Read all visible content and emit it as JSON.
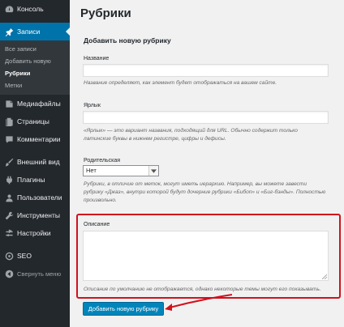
{
  "sidebar": {
    "items": [
      {
        "label": "Консоль",
        "icon": "dashboard-icon"
      },
      {
        "label": "Записи",
        "icon": "pin-icon",
        "active": true
      },
      {
        "label": "Медиафайлы",
        "icon": "media-icon"
      },
      {
        "label": "Страницы",
        "icon": "pages-icon"
      },
      {
        "label": "Комментарии",
        "icon": "comments-icon"
      },
      {
        "label": "Внешний вид",
        "icon": "brush-icon"
      },
      {
        "label": "Плагины",
        "icon": "plugin-icon"
      },
      {
        "label": "Пользователи",
        "icon": "users-icon"
      },
      {
        "label": "Инструменты",
        "icon": "wrench-icon"
      },
      {
        "label": "Настройки",
        "icon": "settings-icon"
      },
      {
        "label": "SEO",
        "icon": "seo-icon"
      },
      {
        "label": "Свернуть меню",
        "icon": "collapse-icon"
      }
    ],
    "submenu": [
      "Все записи",
      "Добавить новую",
      "Рубрики",
      "Метки"
    ]
  },
  "page": {
    "title": "Рубрики",
    "section_title": "Добавить новую рубрику"
  },
  "form": {
    "name": {
      "label": "Название",
      "value": "",
      "description": "Название определяет, как элемент будет отображаться на вашем сайте."
    },
    "slug": {
      "label": "Ярлык",
      "value": "",
      "description_line1": "«Ярлык» — это вариант названия, подходящий для URL. Обычно содержит только",
      "description_line2": "латинские буквы в нижнем регистре, цифры и дефисы."
    },
    "parent": {
      "label": "Родительская",
      "selected": "Нет",
      "description_line1": "Рубрики, в отличие от меток, могут иметь иерархию. Например, вы можете завести",
      "description_line2": "рубрику «Джаз», внутри которой будут дочерние рубрики «Бибоп» и «Биг-бэнды». Полностью",
      "description_line3": "произвольно."
    },
    "description": {
      "label": "Описание",
      "value": "",
      "note": "Описание по умолчанию не отображается, однако некоторые темы могут его показывать."
    },
    "submit_label": "Добавить новую рубрику"
  },
  "colors": {
    "sidebar_bg": "#23282d",
    "active_bg": "#0073aa",
    "button_bg": "#0085ba",
    "annotation_red": "#d1111d"
  }
}
